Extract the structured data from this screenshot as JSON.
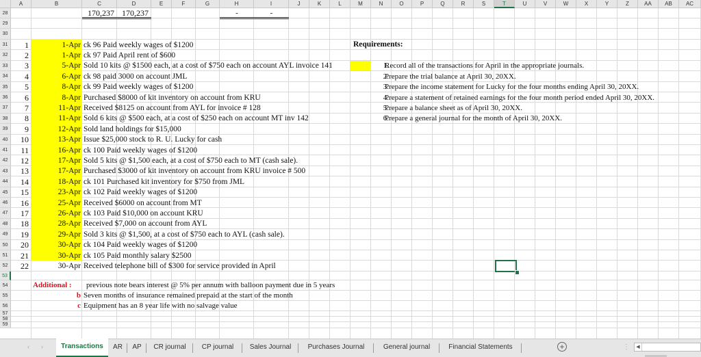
{
  "columns": [
    "A",
    "B",
    "C",
    "D",
    "E",
    "F",
    "G",
    "H",
    "I",
    "J",
    "K",
    "L",
    "M",
    "N",
    "O",
    "P",
    "Q",
    "R",
    "S",
    "T",
    "U",
    "V",
    "W",
    "X",
    "Y",
    "Z",
    "AA",
    "AB",
    "AC"
  ],
  "selected_column": "T",
  "rows": [
    "28",
    "29",
    "30",
    "31",
    "32",
    "33",
    "34",
    "35",
    "36",
    "37",
    "38",
    "39",
    "40",
    "41",
    "42",
    "43",
    "44",
    "45",
    "46",
    "47",
    "48",
    "49",
    "50",
    "51",
    "52",
    "53",
    "54",
    "55",
    "56",
    "57",
    "58",
    "59"
  ],
  "selected_row": "53",
  "totals_row": {
    "c": "170,237",
    "d": "170,237",
    "h": "-",
    "i": "-"
  },
  "transactions": [
    {
      "n": "1",
      "date": "1-Apr",
      "desc": "ck 96 Paid weekly wages of $1200"
    },
    {
      "n": "2",
      "date": "1-Apr",
      "desc": "ck 97 Paid April rent of $600"
    },
    {
      "n": "3",
      "date": "5-Apr",
      "desc": "Sold 10 kits @ $1500 each, at a cost of $750 each on account AYL invoice 141"
    },
    {
      "n": "4",
      "date": "6-Apr",
      "desc": "ck 98 paid 3000 on account JML"
    },
    {
      "n": "5",
      "date": "8-Apr",
      "desc": "ck 99 Paid weekly wages of $1200"
    },
    {
      "n": "6",
      "date": "8-Apr",
      "desc": "Purchased $8000 of kit inventory on account from KRU"
    },
    {
      "n": "7",
      "date": "11-Apr",
      "desc": "Received $8125 on account from AYL for invoice # 128"
    },
    {
      "n": "8",
      "date": "11-Apr",
      "desc": "Sold 6 kits @ $500 each, at a cost of $250 each on account MT inv 142"
    },
    {
      "n": "9",
      "date": "12-Apr",
      "desc": "Sold land holdings for $15,000"
    },
    {
      "n": "10",
      "date": "13-Apr",
      "desc": "Issue $25,000 stock to R. U. Lucky for cash"
    },
    {
      "n": "11",
      "date": "16-Apr",
      "desc": "ck 100 Paid weekly wages of $1200"
    },
    {
      "n": "12",
      "date": "17-Apr",
      "desc": "Sold 5 kits @ $1,500 each, at a cost of $750 each to MT (cash sale)."
    },
    {
      "n": "13",
      "date": "17-Apr",
      "desc": "Purchased $3000 of kit inventory on account from KRU invoice # 500"
    },
    {
      "n": "14",
      "date": "18-Apr",
      "desc": "ck 101 Purchased kit inventory for $750 from JML"
    },
    {
      "n": "15",
      "date": "23-Apr",
      "desc": "ck 102 Paid weekly wages of $1200"
    },
    {
      "n": "16",
      "date": "25-Apr",
      "desc": "Received $6000 on account from MT"
    },
    {
      "n": "17",
      "date": "26-Apr",
      "desc": "ck 103 Paid $10,000 on account KRU"
    },
    {
      "n": "18",
      "date": "28-Apr",
      "desc": "Received $7,000 on account from AYL"
    },
    {
      "n": "19",
      "date": "29-Apr",
      "desc": "Sold 3 kits @ $1,500, at a cost of $750 each to AYL (cash sale)."
    },
    {
      "n": "20",
      "date": "30-Apr",
      "desc": "ck 104 Paid weekly wages of $1200"
    },
    {
      "n": "21",
      "date": "30-Apr",
      "desc": "ck 105 Paid monthly salary $2500"
    },
    {
      "n": "22",
      "date": "30-Apr",
      "desc": "Received telephone bill of $300 for service provided in April"
    }
  ],
  "requirements": {
    "title": "Requirements:",
    "items": [
      {
        "n": "1.",
        "text": "Record all of the transactions for April in the appropriate journals."
      },
      {
        "n": "2.",
        "text": "Prepare the trial balance at April 30, 20XX."
      },
      {
        "n": "3.",
        "text": "Prepare the income statement for Lucky for the four months ending April 30, 20XX."
      },
      {
        "n": "4.",
        "text": "Prepare a statement of retained earnings for the four month period ended April 30, 20XX."
      },
      {
        "n": "5.",
        "text": "Prepare a balance sheet as of April 30, 20XX."
      },
      {
        "n": "6.",
        "text": "Prepare a general journal for the month of April 30, 20XX."
      }
    ]
  },
  "additional": {
    "label": "Additional :",
    "items": [
      {
        "letter": "",
        "text": "previous note bears interest @ 5% per annum with balloon payment due in 5 years"
      },
      {
        "letter": "b",
        "text": "Seven months of insurance remained prepaid at the start of the month"
      },
      {
        "letter": "c",
        "text": "Equipment has an 8 year life with no salvage value"
      }
    ]
  },
  "sheet_tabs": [
    "Transactions",
    "AR",
    "AP",
    "CR journal",
    "CP journal",
    "Sales Journal",
    "Purchases Journal",
    "General journal",
    "Financial Statements"
  ],
  "active_tab": "Transactions",
  "icons": {
    "add_sheet": "+",
    "scroll_left": "◀",
    "prev_sheet": "◀",
    "next_sheet": "▶"
  },
  "colors": {
    "highlight": "#ffff00",
    "accent": "#217346",
    "additional_label": "#e0101a"
  }
}
